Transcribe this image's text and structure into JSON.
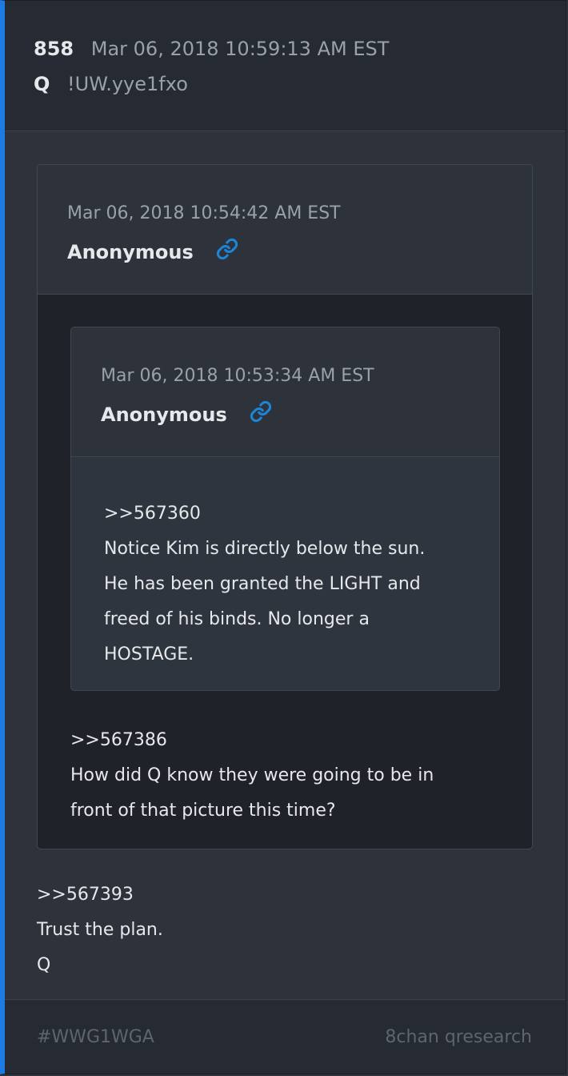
{
  "post": {
    "number": "858",
    "date": "Mar 06, 2018 10:59:13 AM EST",
    "author": "Q",
    "tripcode": "!UW.yye1fxo",
    "body": [
      ">>567393",
      "Trust the plan.",
      "Q"
    ]
  },
  "quote_outer": {
    "date": "Mar 06, 2018 10:54:42 AM EST",
    "author": "Anonymous",
    "body": [
      ">>567386",
      "How did Q know they were going to be in",
      "front of that picture this time?"
    ]
  },
  "quote_inner": {
    "date": "Mar 06, 2018 10:53:34 AM EST",
    "author": "Anonymous",
    "body": [
      ">>567360",
      "Notice Kim is directly below the sun.",
      "He has been granted the LIGHT and",
      "freed of his binds. No longer a",
      "HOSTAGE."
    ]
  },
  "footer": {
    "tag": "#WWG1WGA",
    "source": "8chan qresearch"
  },
  "colors": {
    "accent_bar": "#1d7ce4",
    "link_icon": "#1d86d4"
  },
  "icons": {
    "link": "link-icon"
  }
}
